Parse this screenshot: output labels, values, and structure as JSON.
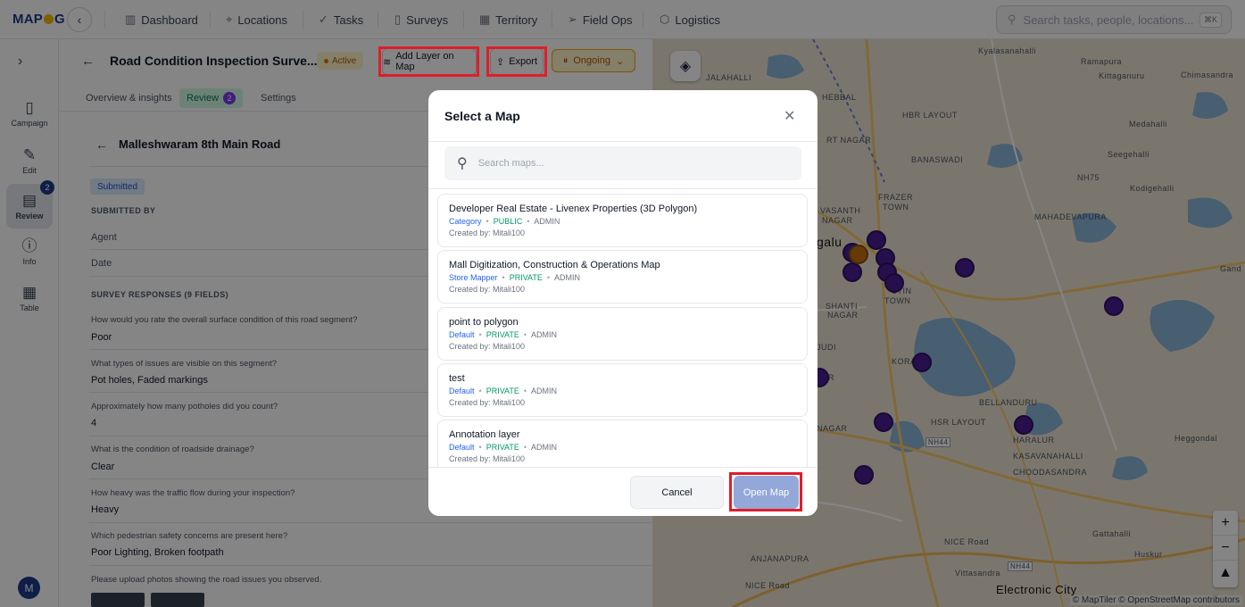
{
  "app": {
    "logo": "MAP",
    "logo_suffix": "G"
  },
  "nav": {
    "items": [
      {
        "label": "Dashboard",
        "icon": "bar-chart-icon"
      },
      {
        "label": "Locations",
        "icon": "map-pin-icon"
      },
      {
        "label": "Tasks",
        "icon": "check-icon"
      },
      {
        "label": "Surveys",
        "icon": "clipboard-icon"
      },
      {
        "label": "Territory",
        "icon": "map-icon"
      },
      {
        "label": "Field Ops",
        "icon": "send-icon"
      },
      {
        "label": "Logistics",
        "icon": "box-icon"
      }
    ],
    "search_placeholder": "Search tasks, people, locations...",
    "search_kbd": "⌘K"
  },
  "sidebar": {
    "items": [
      {
        "label": "Campaign"
      },
      {
        "label": "Edit"
      },
      {
        "label": "Review",
        "badge": "2"
      },
      {
        "label": "Info"
      },
      {
        "label": "Table"
      }
    ],
    "avatar": "M"
  },
  "header": {
    "title": "Road Condition Inspection Surve...",
    "status": "Active",
    "add_layer": "Add Layer on Map",
    "export": "Export",
    "ongoing": "Ongoing"
  },
  "tabs": [
    {
      "label": "Overview & insights"
    },
    {
      "label": "Review",
      "badge": "2"
    },
    {
      "label": "Settings"
    }
  ],
  "submission": {
    "title": "Malleshwaram 8th Main Road",
    "status": "Submitted",
    "submitted_by": "SUBMITTED BY",
    "agent_label": "Agent",
    "date_label": "Date",
    "responses_heading": "SURVEY RESPONSES (9 FIELDS)",
    "responses": [
      {
        "q": "How would you rate the overall surface condition of this road segment?",
        "a": "Poor"
      },
      {
        "q": "What types of issues are visible on this segment?",
        "a": "Pot holes, Faded markings"
      },
      {
        "q": "Approximately how many potholes did you count?",
        "a": "4"
      },
      {
        "q": "What is the condition of roadside drainage?",
        "a": "Clear"
      },
      {
        "q": "How heavy was the traffic flow during your inspection?",
        "a": "Heavy"
      },
      {
        "q": "Which pedestrian safety concerns are present here?",
        "a": "Poor Lighting, Broken footpath"
      },
      {
        "q": "Please upload photos showing the road issues you observed.",
        "a": ""
      }
    ]
  },
  "map": {
    "labels": [
      "Kyalasanahalli",
      "Ramapura",
      "Chimasandra",
      "JALAHALLI",
      "HEBBAL",
      "Kittaganuru",
      "HBR LAYOUT",
      "Medahalli",
      "RT NAGAR",
      "BANASWADI",
      "Seegehalli",
      "NH75",
      "FRAZER",
      "TOWN",
      "Kodigehalli",
      "VASANTH",
      "NAGAR",
      "MAHADEVAPURA",
      "galu",
      "Gand",
      "STIN",
      "TOWN",
      "SHANTI",
      "NAGAR",
      "JUDI",
      "KORA",
      "BELLANDURU",
      "SAR",
      "HSR LAYOUT",
      "NAGAR",
      "HARALUR",
      "NH44",
      "KASAVANAHALLI",
      "Heggondal",
      "CHOODASANDRA",
      "Gattahalli",
      "NICE Road",
      "NH44",
      "ANJANAPURA",
      "Vittasandra",
      "Electronic City",
      "NICE Road",
      "Huskur"
    ],
    "attribution": "© MapTiler © OpenStreetMap contributors"
  },
  "modal": {
    "title": "Select a Map",
    "search_placeholder": "Search maps...",
    "cancel": "Cancel",
    "open": "Open Map",
    "maps": [
      {
        "name": "Developer Real Estate - Livenex Properties (3D Polygon)",
        "category": "Category",
        "visibility": "PUBLIC",
        "role": "ADMIN",
        "created": "Created by: Mitali100"
      },
      {
        "name": "Mall Digitization, Construction & Operations Map",
        "category": "Store Mapper",
        "visibility": "PRIVATE",
        "role": "ADMIN",
        "created": "Created by: Mitali100"
      },
      {
        "name": "point to polygon",
        "category": "Default",
        "visibility": "PRIVATE",
        "role": "ADMIN",
        "created": "Created by: Mitali100"
      },
      {
        "name": "test",
        "category": "Default",
        "visibility": "PRIVATE",
        "role": "ADMIN",
        "created": "Created by: Mitali100"
      },
      {
        "name": "Annotation layer",
        "category": "Default",
        "visibility": "PRIVATE",
        "role": "ADMIN",
        "created": "Created by: Mitali100"
      }
    ]
  },
  "colors": {
    "brand": "#1e3a8a",
    "accent": "#f5b400",
    "highlight": "#e11d2a",
    "pin": "#4c1d95",
    "pin_alt": "#c2700e"
  }
}
